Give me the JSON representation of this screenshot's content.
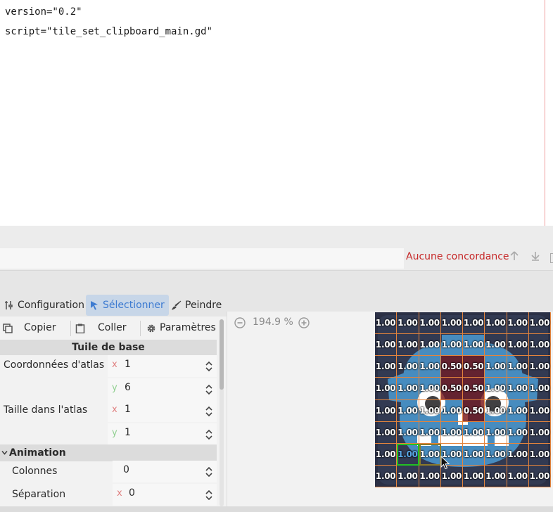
{
  "editor": {
    "lines": [
      "version=\"0.2\"",
      "script=\"tile_set_clipboard_main.gd\""
    ]
  },
  "search": {
    "value": "",
    "no_match": "Aucune concordance"
  },
  "modes": {
    "config": "Configuration",
    "select": "Sélectionner",
    "paint": "Peindre"
  },
  "actions": {
    "copy": "Copier",
    "paste": "Coller",
    "params": "Paramètres"
  },
  "base_tile": {
    "title": "Tuile de base",
    "atlas_coords_label": "Coordonnées d'atlas",
    "atlas_coords": {
      "x": "1",
      "y": "6"
    },
    "atlas_size_label": "Taille dans l'atlas",
    "atlas_size": {
      "x": "1",
      "y": "1"
    }
  },
  "animation": {
    "title": "Animation",
    "columns_label": "Colonnes",
    "columns": "0",
    "separation_label": "Séparation",
    "separation_x": "0"
  },
  "atlas_view": {
    "zoom": "194.9 %",
    "grid": [
      [
        "1.00",
        "1.00",
        "1.00",
        "1.00",
        "1.00",
        "1.00",
        "1.00",
        "1.00"
      ],
      [
        "1.00",
        "1.00",
        "1.00",
        "1.00",
        "1.00",
        "1.00",
        "1.00",
        "1.00"
      ],
      [
        "1.00",
        "1.00",
        "1.00",
        "0.50",
        "0.50",
        "1.00",
        "1.00",
        "1.00"
      ],
      [
        "1.00",
        "1.00",
        "1.00",
        "0.50",
        "0.50",
        "1.00",
        "1.00",
        "1.00"
      ],
      [
        "1.00",
        "1.00",
        "1.00",
        "1.00",
        "0.50",
        "1.00",
        "1.00",
        "1.00"
      ],
      [
        "1.00",
        "1.00",
        "1.00",
        "1.00",
        "1.00",
        "1.00",
        "1.00",
        "1.00"
      ],
      [
        "1.00",
        "1.00",
        "1.00",
        "1.00",
        "1.00",
        "1.00",
        "1.00",
        "1.00"
      ],
      [
        "1.00",
        "1.00",
        "1.00",
        "1.00",
        "1.00",
        "1.00",
        "1.00",
        "1.00"
      ]
    ],
    "half_cells": [
      [
        2,
        3
      ],
      [
        2,
        4
      ],
      [
        3,
        3
      ],
      [
        3,
        4
      ],
      [
        4,
        4
      ]
    ],
    "selected_cell": [
      6,
      1
    ],
    "hover_cell": [
      6,
      2
    ]
  },
  "colors": {
    "accent": "#3d7bd1",
    "error": "#c62828",
    "grid_line": "#e4843c"
  }
}
